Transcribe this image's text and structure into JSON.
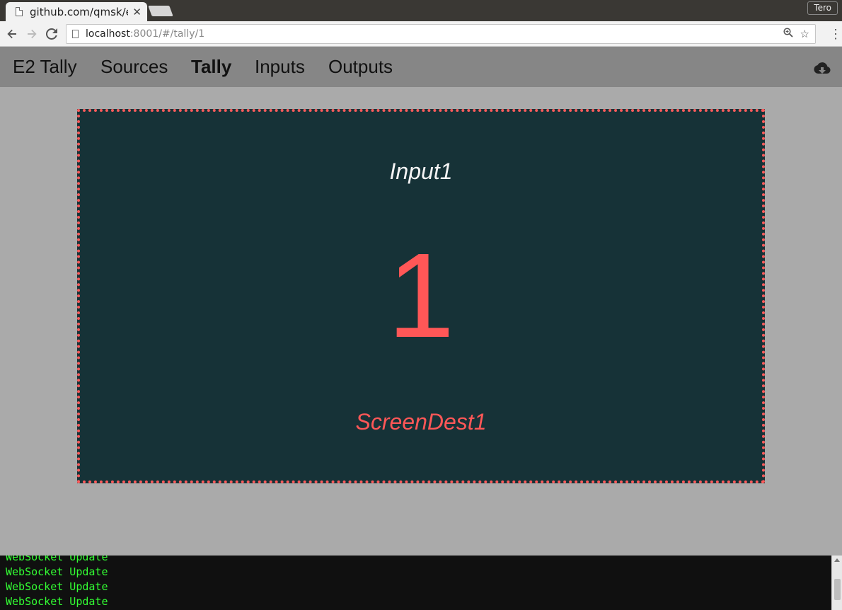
{
  "browser": {
    "tab_title": "github.com/qmsk/e",
    "tab_close": "✕",
    "profile_name": "Tero",
    "url_host": "localhost",
    "url_rest": ":8001/#/tally/1"
  },
  "nav": {
    "brand": "E2 Tally",
    "items": [
      "Sources",
      "Tally",
      "Inputs",
      "Outputs"
    ],
    "active": "Tally"
  },
  "tally": {
    "input": "Input1",
    "number": "1",
    "destination": "ScreenDest1",
    "colors": {
      "background": "#163237",
      "program": "#ff5757",
      "border": "#ff5c5c"
    }
  },
  "console": {
    "lines": [
      "WebSocket Update",
      "WebSocket Update",
      "WebSocket Update",
      "WebSocket Update"
    ]
  },
  "icons": [
    "back-icon",
    "forward-icon",
    "reload-icon",
    "zoom-icon",
    "star-icon",
    "menu-icon",
    "cloud-download-icon"
  ]
}
